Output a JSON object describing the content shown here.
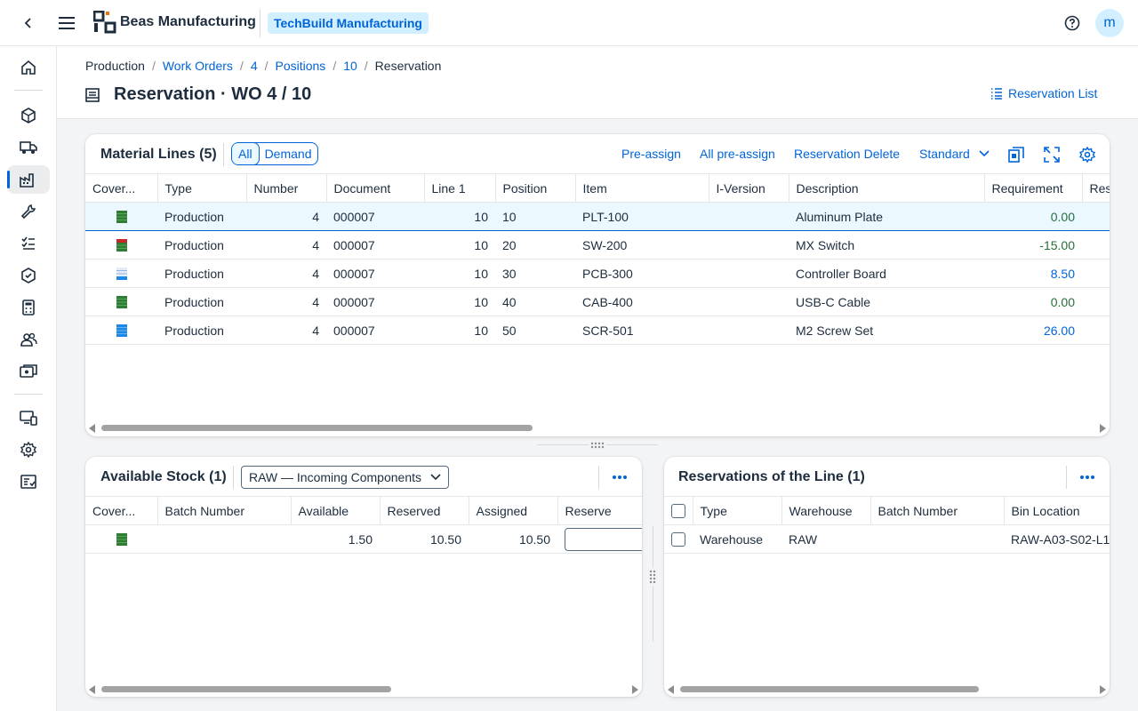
{
  "app": {
    "brand": "Beas Manufacturing",
    "company": "TechBuild Manufacturing",
    "user_initial": "m"
  },
  "icons": {
    "back": "chevron-left-icon",
    "menu": "hamburger-icon",
    "help": "help-icon",
    "title": "document-icon",
    "list": "list-icon"
  },
  "nav": [
    {
      "name": "home",
      "active": false
    },
    {
      "name": "items",
      "active": false
    },
    {
      "name": "delivery",
      "active": false
    },
    {
      "name": "production",
      "active": true
    },
    {
      "name": "tools",
      "active": false
    },
    {
      "name": "tasks",
      "active": false
    },
    {
      "name": "quality",
      "active": false
    },
    {
      "name": "calculator",
      "active": false
    },
    {
      "name": "people",
      "active": false
    },
    {
      "name": "costing",
      "active": false
    },
    {
      "name": "devices",
      "active": false
    },
    {
      "name": "settings",
      "active": false
    },
    {
      "name": "reports",
      "active": false
    }
  ],
  "breadcrumb": {
    "root": "Production",
    "work_orders": "Work Orders",
    "wo": "4",
    "positions": "Positions",
    "pos": "10",
    "current": "Reservation"
  },
  "page": {
    "title": "Reservation · WO 4 / 10",
    "reservation_list": "Reservation List"
  },
  "material_lines": {
    "title": "Material Lines (5)",
    "filter_all": "All",
    "filter_demand": "Demand",
    "actions": {
      "pre_assign": "Pre-assign",
      "all_pre_assign": "All pre-assign",
      "reservation_delete": "Reservation Delete",
      "variant": "Standard"
    },
    "columns": [
      "Cover...",
      "Type",
      "Number",
      "Document",
      "Line 1",
      "Position",
      "Item",
      "I-Version",
      "Description",
      "Requirement",
      "Res"
    ],
    "rows": [
      {
        "cover": "green",
        "type": "Production",
        "number": "4",
        "document": "000007",
        "line1": "10",
        "position": "10",
        "item": "PLT-100",
        "iversion": "",
        "description": "Aluminum Plate",
        "requirement": "0.00",
        "req_color": "green"
      },
      {
        "cover": "red",
        "type": "Production",
        "number": "4",
        "document": "000007",
        "line1": "10",
        "position": "20",
        "item": "SW-200",
        "iversion": "",
        "description": "MX Switch",
        "requirement": "-15.00",
        "req_color": "green"
      },
      {
        "cover": "lightblue",
        "type": "Production",
        "number": "4",
        "document": "000007",
        "line1": "10",
        "position": "30",
        "item": "PCB-300",
        "iversion": "",
        "description": "Controller Board",
        "requirement": "8.50",
        "req_color": "blue"
      },
      {
        "cover": "green",
        "type": "Production",
        "number": "4",
        "document": "000007",
        "line1": "10",
        "position": "40",
        "item": "CAB-400",
        "iversion": "",
        "description": "USB-C Cable",
        "requirement": "0.00",
        "req_color": "green"
      },
      {
        "cover": "blue",
        "type": "Production",
        "number": "4",
        "document": "000007",
        "line1": "10",
        "position": "50",
        "item": "SCR-501",
        "iversion": "",
        "description": "M2 Screw Set",
        "requirement": "26.00",
        "req_color": "blue"
      }
    ]
  },
  "available_stock": {
    "title": "Available Stock (1)",
    "warehouse_select": "RAW — Incoming Components",
    "columns": [
      "Cover...",
      "Batch Number",
      "Available",
      "Reserved",
      "Assigned",
      "Reserve"
    ],
    "rows": [
      {
        "cover": "green",
        "batch": "",
        "available": "1.50",
        "reserved": "10.50",
        "assigned": "10.50",
        "reserve": ""
      }
    ]
  },
  "reservations": {
    "title": "Reservations of the Line (1)",
    "columns": [
      "Type",
      "Warehouse",
      "Batch Number",
      "Bin Location"
    ],
    "rows": [
      {
        "type": "Warehouse",
        "warehouse": "RAW",
        "batch": "",
        "bin": "RAW-A03-S02-L1"
      }
    ]
  },
  "colors": {
    "accent": "#0064d9",
    "cover_green": "#2e7d32",
    "cover_red": "#c62828",
    "cover_blue": "#1e88e5",
    "cover_lightblue": "#90b4e0"
  }
}
